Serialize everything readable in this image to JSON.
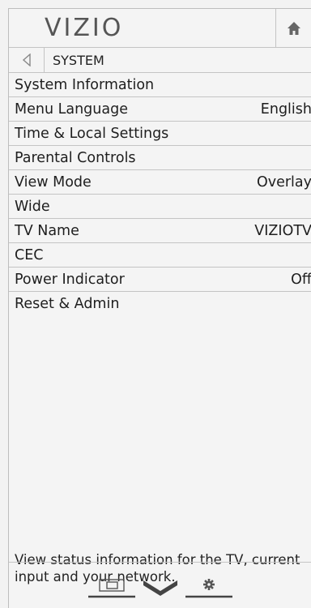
{
  "header": {
    "brand": "VIZIO",
    "home_icon": "home-icon"
  },
  "breadcrumb": {
    "back_icon": "back-arrow-icon",
    "title": "SYSTEM"
  },
  "menu": [
    {
      "label": "System Information",
      "value": ""
    },
    {
      "label": "Menu Language",
      "value": "English"
    },
    {
      "label": "Time & Local Settings",
      "value": ""
    },
    {
      "label": "Parental Controls",
      "value": ""
    },
    {
      "label": "View Mode",
      "value": "Overlay"
    },
    {
      "label": "Wide",
      "value": ""
    },
    {
      "label": "TV Name",
      "value": "VIZIOTV"
    },
    {
      "label": "CEC",
      "value": ""
    },
    {
      "label": "Power Indicator",
      "value": "Off"
    },
    {
      "label": "Reset & Admin",
      "value": ""
    }
  ],
  "description": "View status information for the TV, current input and your network.",
  "bottom_bar": {
    "icons": [
      "input-icon",
      "vizio-v-icon",
      "settings-gear-icon"
    ]
  }
}
